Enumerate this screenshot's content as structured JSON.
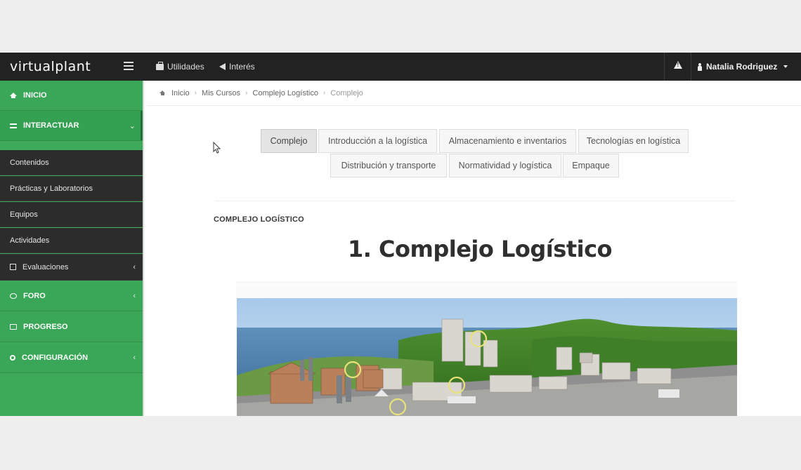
{
  "topbar": {
    "logo": "virtualplant",
    "menu": [
      {
        "label": "Utilidades",
        "icon": "briefcase-icon"
      },
      {
        "label": "Interés",
        "icon": "bullhorn-icon"
      }
    ],
    "user_name": "Natalia Rodriguez"
  },
  "sidebar": {
    "items": [
      {
        "label": "INICIO",
        "icon": "home-icon"
      },
      {
        "label": "INTERACTUAR",
        "icon": "exchange-icon"
      },
      {
        "label": "Contenidos"
      },
      {
        "label": "Prácticas y Laboratorios"
      },
      {
        "label": "Equipos"
      },
      {
        "label": "Actividades"
      },
      {
        "label": "Evaluaciones",
        "icon": "edit-icon"
      },
      {
        "label": "FORO",
        "icon": "comments-icon"
      },
      {
        "label": "PROGRESO",
        "icon": "chart-icon"
      },
      {
        "label": "CONFIGURACIÓN",
        "icon": "cogs-icon"
      }
    ]
  },
  "breadcrumb": [
    "Inicio",
    "Mis Cursos",
    "Complejo Logístico",
    "Complejo"
  ],
  "tabs": [
    "Complejo",
    "Introducción a la logística",
    "Almacenamiento e inventarios",
    "Tecnologías en logística",
    "Distribución y transporte",
    "Normatividad y logística",
    "Empaque"
  ],
  "active_tab": "Complejo",
  "section_label": "COMPLEJO LOGÍSTICO",
  "page_title": "1. Complejo Logístico",
  "colors": {
    "topbar": "#222222",
    "sidebar_green": "#3aa657",
    "sidebar_dark": "#2c2c2c"
  }
}
